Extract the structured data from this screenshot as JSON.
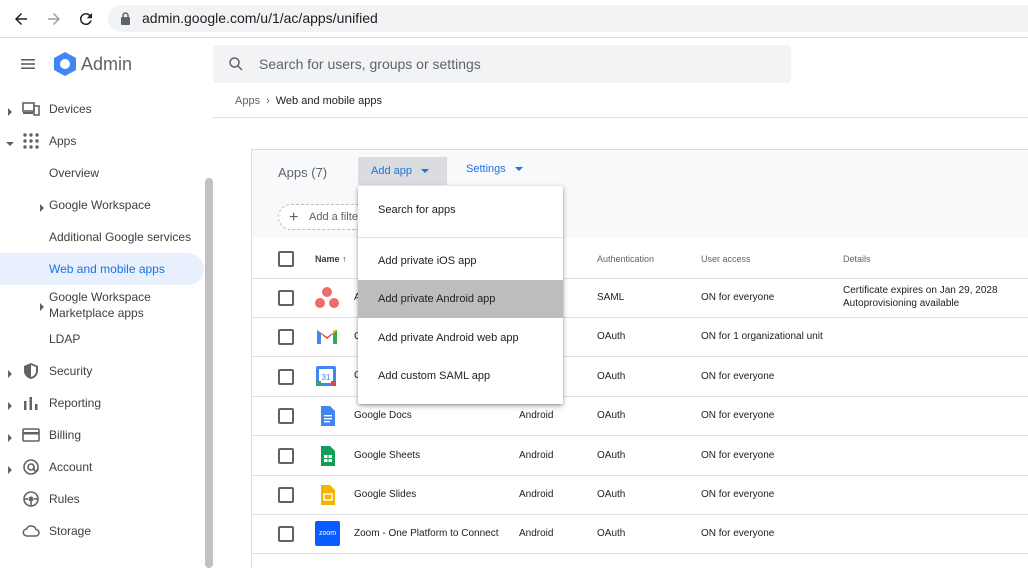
{
  "browser": {
    "url": "admin.google.com/u/1/ac/apps/unified"
  },
  "header": {
    "brand": "Admin",
    "search_placeholder": "Search for users, groups or settings"
  },
  "sidebar": {
    "items": [
      {
        "label": "Devices"
      },
      {
        "label": "Apps"
      },
      {
        "label": "Overview"
      },
      {
        "label": "Google Workspace"
      },
      {
        "label": "Additional Google services"
      },
      {
        "label": "Web and mobile apps"
      },
      {
        "label": "Google Workspace"
      },
      {
        "label": "Marketplace apps"
      },
      {
        "label": "LDAP"
      },
      {
        "label": "Security"
      },
      {
        "label": "Reporting"
      },
      {
        "label": "Billing"
      },
      {
        "label": "Account"
      },
      {
        "label": "Rules"
      },
      {
        "label": "Storage"
      }
    ]
  },
  "breadcrumb": {
    "parent": "Apps",
    "separator": "›",
    "current": "Web and mobile apps"
  },
  "panel": {
    "title": "Apps (7)",
    "add_app": "Add app",
    "settings": "Settings",
    "filter": "Add a filter"
  },
  "table": {
    "headers": {
      "name": "Name",
      "auth": "Authentication",
      "access": "User access",
      "details": "Details"
    },
    "rows": [
      {
        "name": "A",
        "platform": "",
        "auth": "SAML",
        "access": "ON for everyone",
        "details1": "Certificate expires on Jan 29, 2028",
        "details2": "Autoprovisioning available",
        "icon": "asana-icon"
      },
      {
        "name": "G",
        "platform": "",
        "auth": "OAuth",
        "access": "ON for 1 organizational unit",
        "details1": "",
        "details2": "",
        "icon": "gmail-icon"
      },
      {
        "name": "G",
        "platform": "",
        "auth": "OAuth",
        "access": "ON for everyone",
        "details1": "",
        "details2": "",
        "icon": "calendar-icon"
      },
      {
        "name": "Google Docs",
        "platform": "Android",
        "auth": "OAuth",
        "access": "ON for everyone",
        "details1": "",
        "details2": "",
        "icon": "docs-icon"
      },
      {
        "name": "Google Sheets",
        "platform": "Android",
        "auth": "OAuth",
        "access": "ON for everyone",
        "details1": "",
        "details2": "",
        "icon": "sheets-icon"
      },
      {
        "name": "Google Slides",
        "platform": "Android",
        "auth": "OAuth",
        "access": "ON for everyone",
        "details1": "",
        "details2": "",
        "icon": "slides-icon"
      },
      {
        "name": "Zoom - One Platform to Connect",
        "platform": "Android",
        "auth": "OAuth",
        "access": "ON for everyone",
        "details1": "",
        "details2": "",
        "icon": "zoom-icon",
        "icon_text": "zoom"
      }
    ]
  },
  "dropdown": {
    "items": [
      {
        "label": "Search for apps"
      },
      {
        "label": "Add private iOS app"
      },
      {
        "label": "Add private Android app"
      },
      {
        "label": "Add private Android web app"
      },
      {
        "label": "Add custom SAML app"
      }
    ]
  }
}
